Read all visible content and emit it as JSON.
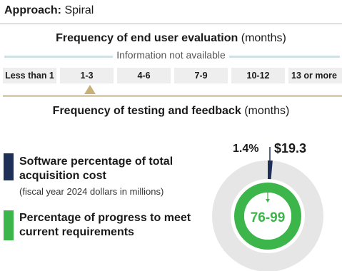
{
  "header": {
    "approach_label": "Approach:",
    "approach_value": "Spiral"
  },
  "eval": {
    "title_bold": "Frequency of end user evaluation",
    "title_unit": "(months)",
    "note": "Information not available"
  },
  "scale": {
    "cells": [
      "Less than 1",
      "1-3",
      "4-6",
      "7-9",
      "10-12",
      "13 or more"
    ],
    "selected": "1-3"
  },
  "testing": {
    "title_bold": "Frequency of testing and feedback",
    "title_unit": "(months)"
  },
  "legend": {
    "software": {
      "title": "Software percentage of total acquisition cost",
      "subtitle": "(fiscal year 2024 dollars in millions)"
    },
    "progress": {
      "title": "Percentage of progress to meet current requirements"
    }
  },
  "chart_data": {
    "type": "pie",
    "software_percent": 1.4,
    "software_percent_label": "1.4%",
    "total_cost_label": "$19.3",
    "progress_label": "76-99",
    "progress_range": [
      76,
      99
    ]
  },
  "colors": {
    "navy": "#1f3058",
    "green": "#3cb54a",
    "ring": "#e6e6e6",
    "marker": "#c8b07a",
    "info_line": "#cfe1e2"
  }
}
